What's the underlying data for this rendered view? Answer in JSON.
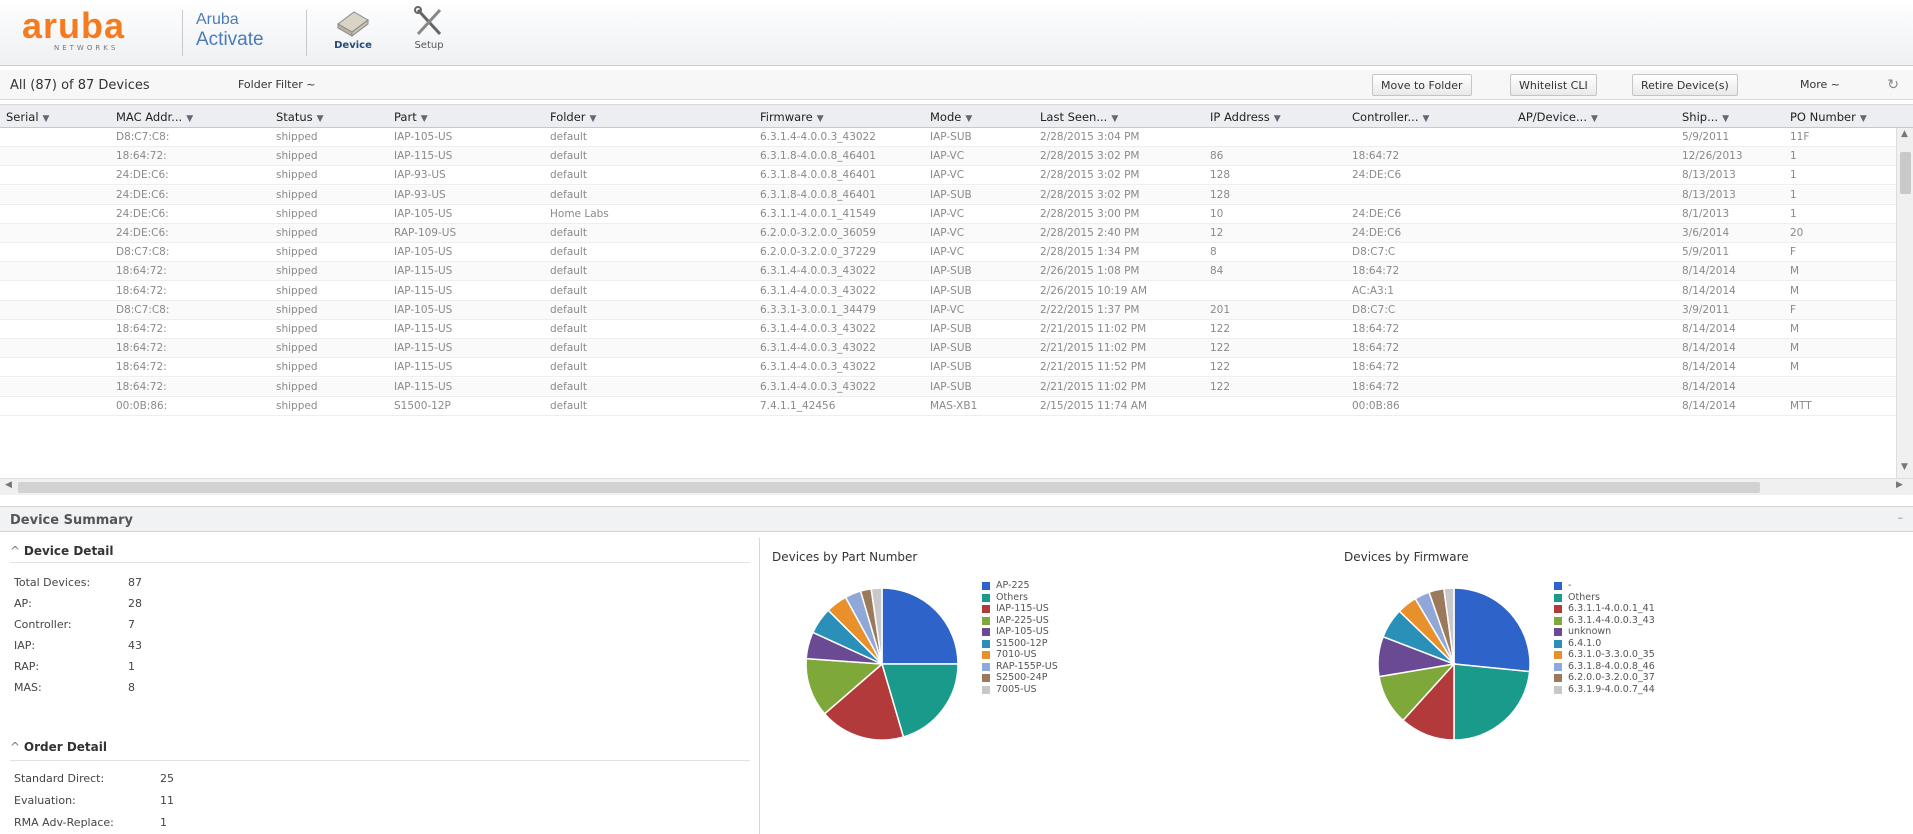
{
  "header": {
    "logo_text": "aruba",
    "logo_sub": "NETWORKS",
    "product_line1": "Aruba",
    "product_line2": "Activate",
    "nav": [
      {
        "label": "Device",
        "icon": "device-folder-icon"
      },
      {
        "label": "Setup",
        "icon": "wrench-screwdriver-icon"
      }
    ]
  },
  "toolbar": {
    "count_text": "All (87) of 87 Devices",
    "folder_filter": "Folder Filter ~",
    "buttons": [
      "Move to Folder",
      "Whitelist CLI",
      "Retire Device(s)"
    ],
    "more": "More ~"
  },
  "table": {
    "columns": [
      "Serial",
      "MAC Addr...",
      "Status",
      "Part",
      "Folder",
      "Firmware",
      "Mode",
      "Last Seen...",
      "IP Address",
      "Controller...",
      "AP/Device...",
      "Ship...",
      "PO Number"
    ],
    "rows": [
      [
        "",
        "D8:C7:C8:",
        "shipped",
        "IAP-105-US",
        "default",
        "6.3.1.4-4.0.0.3_43022",
        "IAP-SUB",
        "2/28/2015 3:04 PM",
        "",
        "",
        "",
        "5/9/2011",
        "11F"
      ],
      [
        "",
        "18:64:72:",
        "shipped",
        "IAP-115-US",
        "default",
        "6.3.1.8-4.0.0.8_46401",
        "IAP-VC",
        "2/28/2015 3:02 PM",
        "86",
        "18:64:72",
        "",
        "12/26/2013",
        "1"
      ],
      [
        "",
        "24:DE:C6:",
        "shipped",
        "IAP-93-US",
        "default",
        "6.3.1.8-4.0.0.8_46401",
        "IAP-VC",
        "2/28/2015 3:02 PM",
        "128",
        "24:DE:C6",
        "",
        "8/13/2013",
        "1"
      ],
      [
        "",
        "24:DE:C6:",
        "shipped",
        "IAP-93-US",
        "default",
        "6.3.1.8-4.0.0.8_46401",
        "IAP-SUB",
        "2/28/2015 3:02 PM",
        "128",
        "",
        "",
        "8/13/2013",
        "1"
      ],
      [
        "",
        "24:DE:C6:",
        "shipped",
        "IAP-105-US",
        "Home Labs",
        "6.3.1.1-4.0.0.1_41549",
        "IAP-VC",
        "2/28/2015 3:00 PM",
        "10",
        "24:DE:C6",
        "",
        "8/1/2013",
        "1"
      ],
      [
        "",
        "24:DE:C6:",
        "shipped",
        "RAP-109-US",
        "default",
        "6.2.0.0-3.2.0.0_36059",
        "IAP-VC",
        "2/28/2015 2:40 PM",
        "12",
        "24:DE:C6",
        "",
        "3/6/2014",
        "20"
      ],
      [
        "",
        "D8:C7:C8:",
        "shipped",
        "IAP-105-US",
        "default",
        "6.2.0.0-3.2.0.0_37229",
        "IAP-VC",
        "2/28/2015 1:34 PM",
        "8",
        "D8:C7:C",
        "",
        "5/9/2011",
        "F"
      ],
      [
        "",
        "18:64:72:",
        "shipped",
        "IAP-115-US",
        "default",
        "6.3.1.4-4.0.0.3_43022",
        "IAP-SUB",
        "2/26/2015 1:08 PM",
        "84",
        "18:64:72",
        "",
        "8/14/2014",
        "M"
      ],
      [
        "",
        "18:64:72:",
        "shipped",
        "IAP-115-US",
        "default",
        "6.3.1.4-4.0.0.3_43022",
        "IAP-SUB",
        "2/26/2015 10:19 AM",
        "",
        "AC:A3:1",
        "",
        "8/14/2014",
        "M"
      ],
      [
        "",
        "D8:C7:C8:",
        "shipped",
        "IAP-105-US",
        "default",
        "6.3.3.1-3.0.0.1_34479",
        "IAP-VC",
        "2/22/2015 1:37 PM",
        "201",
        "D8:C7:C",
        "",
        "3/9/2011",
        "F"
      ],
      [
        "",
        "18:64:72:",
        "shipped",
        "IAP-115-US",
        "default",
        "6.3.1.4-4.0.0.3_43022",
        "IAP-SUB",
        "2/21/2015 11:02 PM",
        "122",
        "18:64:72",
        "",
        "8/14/2014",
        "M"
      ],
      [
        "",
        "18:64:72:",
        "shipped",
        "IAP-115-US",
        "default",
        "6.3.1.4-4.0.0.3_43022",
        "IAP-SUB",
        "2/21/2015 11:02 PM",
        "122",
        "18:64:72",
        "",
        "8/14/2014",
        "M"
      ],
      [
        "",
        "18:64:72:",
        "shipped",
        "IAP-115-US",
        "default",
        "6.3.1.4-4.0.0.3_43022",
        "IAP-SUB",
        "2/21/2015 11:52 PM",
        "122",
        "18:64:72",
        "",
        "8/14/2014",
        "M"
      ],
      [
        "",
        "18:64:72:",
        "shipped",
        "IAP-115-US",
        "default",
        "6.3.1.4-4.0.0.3_43022",
        "IAP-SUB",
        "2/21/2015 11:02 PM",
        "122",
        "18:64:72",
        "",
        "8/14/2014",
        ""
      ],
      [
        "",
        "00:0B:86:",
        "shipped",
        "S1500-12P",
        "default",
        "7.4.1.1_42456",
        "MAS-XB1",
        "2/15/2015 11:74 AM",
        "",
        "00:0B:86",
        "",
        "8/14/2014",
        "MTT"
      ]
    ]
  },
  "summary": {
    "title": "Device Summary",
    "device_detail": {
      "title": "Device Detail",
      "items": [
        {
          "k": "Total Devices:",
          "v": "87"
        },
        {
          "k": "AP:",
          "v": "28"
        },
        {
          "k": "Controller:",
          "v": "7"
        },
        {
          "k": "IAP:",
          "v": "43"
        },
        {
          "k": "RAP:",
          "v": "1"
        },
        {
          "k": "MAS:",
          "v": "8"
        }
      ]
    },
    "order_detail": {
      "title": "Order Detail",
      "items": [
        {
          "k": "Standard Direct:",
          "v": "25"
        },
        {
          "k": "Evaluation:",
          "v": "11"
        },
        {
          "k": "RMA Adv-Replace:",
          "v": "1"
        }
      ]
    }
  },
  "colors": {
    "blue": "#2e63c9",
    "teal": "#1a9a8a",
    "red": "#b23a3a",
    "green": "#7fa83a",
    "purple": "#6a4a92",
    "cyan": "#2a90b8",
    "orange": "#e8912c",
    "lightblue": "#8fa8d8",
    "pink": "#d87878",
    "gray": "#c8c8c8",
    "brown": "#9a7a5a"
  },
  "chart_data": [
    {
      "type": "pie",
      "title": "Devices by Part Number",
      "labels": [
        "AP-225",
        "Others",
        "IAP-115-US",
        "IAP-225-US",
        "IAP-105-US",
        "S1500-12P",
        "7010-US",
        "RAP-155P-US",
        "S2500-24P",
        "7005-US"
      ],
      "values": [
        22,
        18,
        16,
        11,
        5,
        5,
        4,
        3,
        2,
        2
      ]
    },
    {
      "type": "pie",
      "title": "Devices by Firmware",
      "labels": [
        "-",
        "Others",
        "6.3.1.1-4.0.0.1_41",
        "6.3.1.4-4.0.0.3_43",
        "unknown",
        "6.4.1.0",
        "6.3.1.0-3.3.0.0_35",
        "6.3.1.8-4.0.0.8_46",
        "6.2.0.0-3.2.0.0_37",
        "6.3.1.9-4.0.0.7_44"
      ],
      "values": [
        25,
        22,
        11,
        10,
        8,
        6,
        4,
        3,
        3,
        2
      ]
    }
  ]
}
